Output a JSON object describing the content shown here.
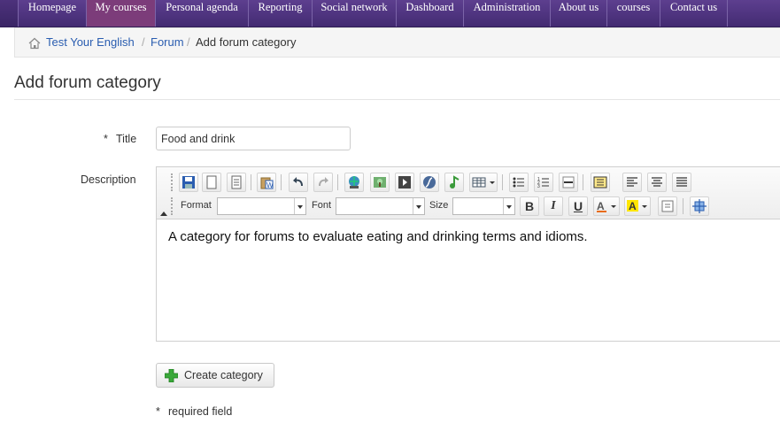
{
  "nav": {
    "items": [
      {
        "label": "Homepage",
        "active": false
      },
      {
        "label": "My courses",
        "active": true
      },
      {
        "label": "Personal agenda",
        "active": false
      },
      {
        "label": "Reporting",
        "active": false
      },
      {
        "label": "Social network",
        "active": false
      },
      {
        "label": "Dashboard",
        "active": false
      },
      {
        "label": "Administration",
        "active": false
      },
      {
        "label": "About us",
        "active": false
      },
      {
        "label": "courses",
        "active": false
      },
      {
        "label": "Contact us",
        "active": false
      }
    ],
    "bg_color": "#4f3580",
    "active_color": "#7c3c7a"
  },
  "breadcrumb": {
    "home_icon": "home-icon",
    "items": [
      "Test Your English",
      "Forum",
      "Add forum category"
    ],
    "separator": "/"
  },
  "page": {
    "title": "Add forum category"
  },
  "form": {
    "required_marker": "*",
    "title_label": "Title",
    "title_value": "Food and drink",
    "description_label": "Description",
    "editor": {
      "format_label": "Format",
      "font_label": "Font",
      "size_label": "Size",
      "content": "A category for forums to evaluate eating and drinking terms and idioms.",
      "icons": [
        "save-icon",
        "new-page-icon",
        "templates-icon",
        "paste-word-icon",
        "undo-icon",
        "redo-icon",
        "link-icon",
        "image-icon",
        "flash-icon",
        "flash-object-icon",
        "audio-icon",
        "table-icon",
        "bulleted-list-icon",
        "numbered-list-icon",
        "horizontal-rule-icon",
        "blockquote-icon",
        "align-left-icon",
        "align-center-icon",
        "justify-icon",
        "bold-icon",
        "italic-icon",
        "underline-icon",
        "text-color-icon",
        "bg-color-icon",
        "remove-format-icon",
        "maximize-icon"
      ]
    },
    "submit_label": "Create category",
    "required_note": "required field"
  },
  "colors": {
    "link": "#2a5db0",
    "required": "#cc0000"
  }
}
